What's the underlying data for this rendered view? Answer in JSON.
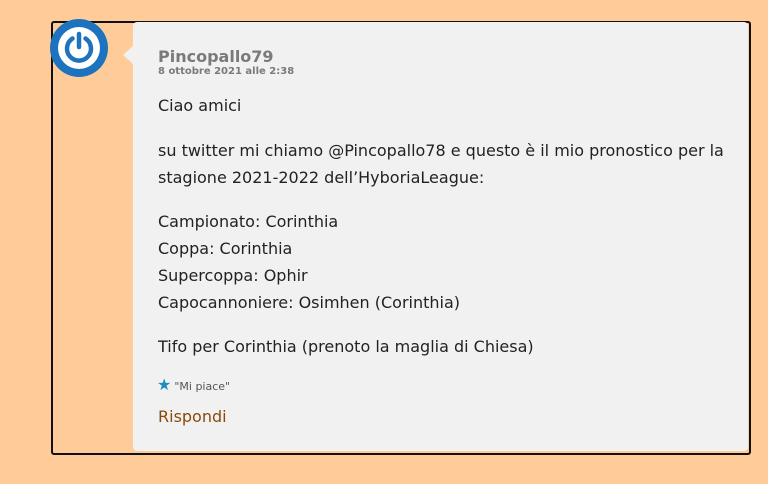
{
  "comment": {
    "author": "Pincopallo79",
    "date": "8 ottobre 2021 alle 2:38",
    "greeting": "Ciao amici",
    "intro_line1": "su twitter mi chiamo @Pincopallo78 e questo è il mio pronostico per la",
    "intro_line2": "stagione 2021-2022 dell’HyboriaLeague:",
    "predictions": [
      "Campionato: Corinthia",
      "Coppa: Corinthia",
      "Supercoppa: Ophir",
      "Capocannoniere: Osimhen (Corinthia)"
    ],
    "closing": "Tifo per Corinthia (prenoto la maglia di Chiesa)",
    "like_label": "\"Mi piace\"",
    "reply_label": "Rispondi",
    "avatar_icon": "power-icon",
    "like_icon": "star-icon"
  },
  "colors": {
    "page_background": "#ffcb99",
    "bubble_background": "#f1f1f1",
    "avatar_blue": "#1e73be",
    "reply_link": "#8a4a0a"
  }
}
